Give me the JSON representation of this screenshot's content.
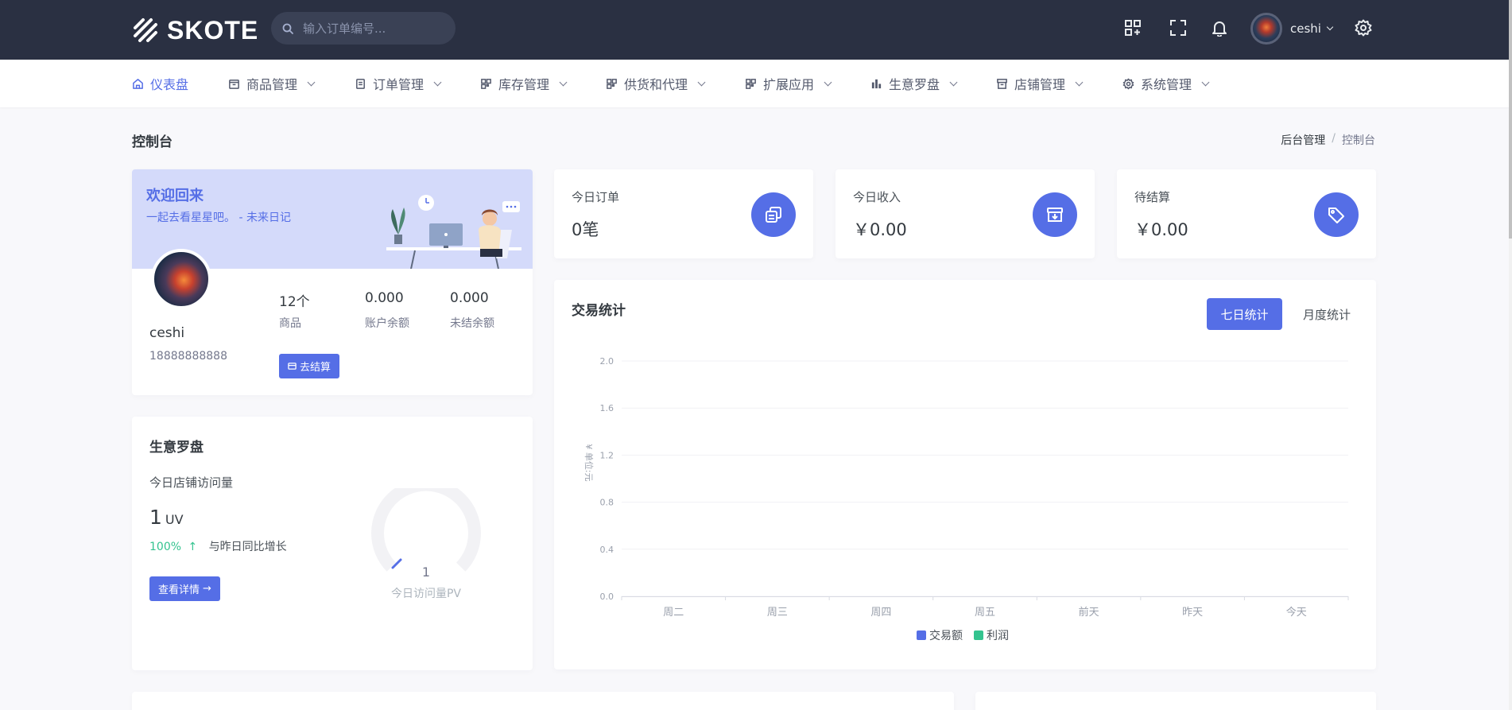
{
  "header": {
    "logo_text": "SKOTE",
    "search_placeholder": "输入订单编号...",
    "user_name": "ceshi"
  },
  "nav": {
    "items": [
      {
        "label": "仪表盘",
        "icon": "home-icon",
        "active": true,
        "has_menu": false
      },
      {
        "label": "商品管理",
        "icon": "box-icon",
        "active": false,
        "has_menu": true
      },
      {
        "label": "订单管理",
        "icon": "receipt-icon",
        "active": false,
        "has_menu": true
      },
      {
        "label": "库存管理",
        "icon": "grid-icon",
        "active": false,
        "has_menu": true
      },
      {
        "label": "供货和代理",
        "icon": "grid-icon",
        "active": false,
        "has_menu": true
      },
      {
        "label": "扩展应用",
        "icon": "grid-icon",
        "active": false,
        "has_menu": true
      },
      {
        "label": "生意罗盘",
        "icon": "bar-chart-icon",
        "active": false,
        "has_menu": true
      },
      {
        "label": "店铺管理",
        "icon": "archive-icon",
        "active": false,
        "has_menu": true
      },
      {
        "label": "系统管理",
        "icon": "cog-icon",
        "active": false,
        "has_menu": true
      }
    ]
  },
  "page": {
    "title": "控制台",
    "breadcrumb": [
      "后台管理",
      "控制台"
    ]
  },
  "welcome": {
    "title": "欢迎回来",
    "subtitle": "一起去看星星吧。 - 未来日记",
    "name": "ceshi",
    "phone": "18888888888",
    "stats": [
      {
        "value": "12个",
        "label": "商品"
      },
      {
        "value": "0.000",
        "label": "账户余额"
      },
      {
        "value": "0.000",
        "label": "未结余额"
      }
    ],
    "settle_button": "去结算"
  },
  "mini_stats": [
    {
      "label": "今日订单",
      "value": "0笔",
      "icon": "copy-icon"
    },
    {
      "label": "今日收入",
      "value": "￥0.00",
      "icon": "archive-in-icon"
    },
    {
      "label": "待结算",
      "value": "￥0.00",
      "icon": "tag-icon"
    }
  ],
  "compass": {
    "title": "生意罗盘",
    "visits_label": "今日店铺访问量",
    "uv_value": "1",
    "uv_unit": "UV",
    "growth_pct": "100%",
    "growth_text": "与昨日同比增长",
    "detail_button": "查看详情",
    "gauge_value": "1",
    "gauge_label": "今日访问量PV"
  },
  "trade": {
    "title": "交易统计",
    "tab_week": "七日统计",
    "tab_month": "月度统计"
  },
  "chart_data": {
    "type": "bar",
    "title": "",
    "xlabel": "",
    "ylabel": "单位:元",
    "categories": [
      "周二",
      "周三",
      "周四",
      "周五",
      "前天",
      "昨天",
      "今天"
    ],
    "yticks": [
      "0.0",
      "0.4",
      "0.8",
      "1.2",
      "1.6",
      "2.0"
    ],
    "ylim": [
      0,
      2
    ],
    "series": [
      {
        "name": "交易额",
        "color": "#556ee6",
        "values": [
          0,
          0,
          0,
          0,
          0,
          0,
          0
        ]
      },
      {
        "name": "利润",
        "color": "#34c38f",
        "values": [
          0,
          0,
          0,
          0,
          0,
          0,
          0
        ]
      }
    ],
    "grid": true,
    "legend": "bottom-center"
  }
}
